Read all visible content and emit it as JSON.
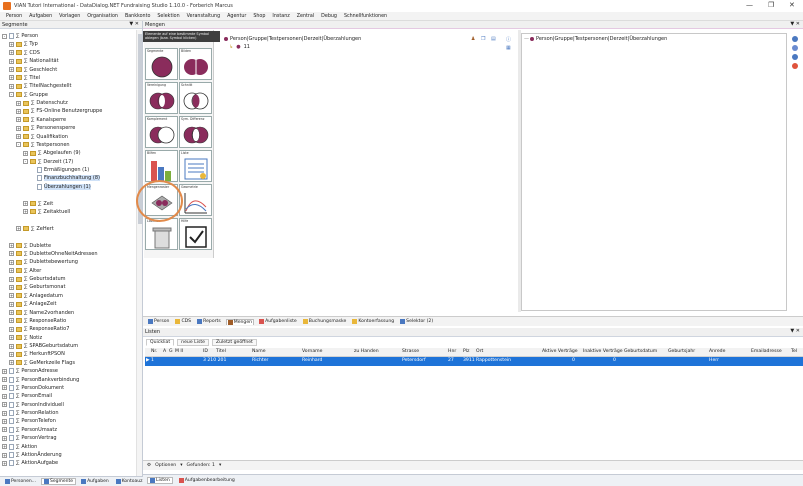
{
  "window": {
    "title": "VIAN Tutori International - DataDialog.NET Fundraising Studio 1.10.0 - Forberich Marcus"
  },
  "menu": [
    "Person",
    "Aufgaben",
    "Vorlagen",
    "Organisation",
    "Bankkonto",
    "Selektion",
    "Veranstaltung",
    "Agentur",
    "Shop",
    "Instanz",
    "Zentral",
    "Debug",
    "Schnellfunktionen"
  ],
  "segments_pane": {
    "title": "Segmente"
  },
  "tree": [
    {
      "label": "Person",
      "level": 0,
      "exp": "-",
      "icon": "doc"
    },
    {
      "label": "Typ",
      "level": 1,
      "exp": "+",
      "icon": "fold"
    },
    {
      "label": "CDS",
      "level": 1,
      "exp": "+",
      "icon": "fold"
    },
    {
      "label": "Nationalität",
      "level": 1,
      "exp": "+",
      "icon": "fold"
    },
    {
      "label": "Geschlecht",
      "level": 1,
      "exp": "+",
      "icon": "fold"
    },
    {
      "label": "Titel",
      "level": 1,
      "exp": "+",
      "icon": "fold"
    },
    {
      "label": "TitelNachgestellt",
      "level": 1,
      "exp": "+",
      "icon": "fold"
    },
    {
      "label": "Gruppe",
      "level": 1,
      "exp": "-",
      "icon": "fold"
    },
    {
      "label": "Datenschutz",
      "level": 2,
      "exp": "+",
      "icon": "fold"
    },
    {
      "label": "FS-Online Benutzergruppe",
      "level": 2,
      "exp": "+",
      "icon": "fold"
    },
    {
      "label": "Kanalsperre",
      "level": 2,
      "exp": "+",
      "icon": "fold"
    },
    {
      "label": "Personensperre",
      "level": 2,
      "exp": "+",
      "icon": "fold"
    },
    {
      "label": "Qualifikation",
      "level": 2,
      "exp": "+",
      "icon": "fold"
    },
    {
      "label": "Testpersonen",
      "level": 2,
      "exp": "-",
      "icon": "fold"
    },
    {
      "label": "Abgelaufen (9)",
      "level": 3,
      "exp": "+",
      "icon": "fold"
    },
    {
      "label": "Derzeit (17)",
      "level": 3,
      "exp": "-",
      "icon": "fold"
    },
    {
      "label": "Ermäßigungen (1)",
      "level": 4,
      "exp": "",
      "icon": "doc"
    },
    {
      "label": "Finanzbuchhaltung (8)",
      "level": 4,
      "exp": "",
      "icon": "doc",
      "sel": true
    },
    {
      "label": "Überzahlungen (1)",
      "level": 4,
      "exp": "",
      "icon": "doc",
      "sel": true
    },
    {
      "label": "",
      "level": 4,
      "exp": "",
      "icon": "none"
    },
    {
      "label": "Zeit",
      "level": 3,
      "exp": "+",
      "icon": "fold"
    },
    {
      "label": "Zeitaktuell",
      "level": 3,
      "exp": "+",
      "icon": "fold"
    },
    {
      "label": "",
      "level": 3,
      "exp": "",
      "icon": "none"
    },
    {
      "label": "ZeHert",
      "level": 2,
      "exp": "+",
      "icon": "fold"
    },
    {
      "label": "",
      "level": 2,
      "exp": "",
      "icon": "none"
    },
    {
      "label": "Dublette",
      "level": 1,
      "exp": "+",
      "icon": "fold"
    },
    {
      "label": "DubletteOhneNeitAdressen",
      "level": 1,
      "exp": "+",
      "icon": "fold"
    },
    {
      "label": "Dublettebewertung",
      "level": 1,
      "exp": "+",
      "icon": "fold"
    },
    {
      "label": "Alter",
      "level": 1,
      "exp": "+",
      "icon": "fold"
    },
    {
      "label": "Geburtsdatum",
      "level": 1,
      "exp": "+",
      "icon": "fold"
    },
    {
      "label": "Geburtsmonat",
      "level": 1,
      "exp": "+",
      "icon": "fold"
    },
    {
      "label": "Anlagedatum",
      "level": 1,
      "exp": "+",
      "icon": "fold"
    },
    {
      "label": "AnlageZeit",
      "level": 1,
      "exp": "+",
      "icon": "fold"
    },
    {
      "label": "Name2vorhanden",
      "level": 1,
      "exp": "+",
      "icon": "fold"
    },
    {
      "label": "ResponseRatio",
      "level": 1,
      "exp": "+",
      "icon": "fold"
    },
    {
      "label": "ResponseRatio7",
      "level": 1,
      "exp": "+",
      "icon": "fold"
    },
    {
      "label": "Notiz",
      "level": 1,
      "exp": "+",
      "icon": "fold"
    },
    {
      "label": "SPABGeburtsdatum",
      "level": 1,
      "exp": "+",
      "icon": "fold"
    },
    {
      "label": "HerkunftPSON",
      "level": 1,
      "exp": "+",
      "icon": "fold"
    },
    {
      "label": "GeMerkzeile Flags",
      "level": 1,
      "exp": "+",
      "icon": "fold"
    },
    {
      "label": "PersonAdresse",
      "level": 0,
      "exp": "+",
      "icon": "doc"
    },
    {
      "label": "PersonBankverbindung",
      "level": 0,
      "exp": "+",
      "icon": "doc"
    },
    {
      "label": "PersonDokument",
      "level": 0,
      "exp": "+",
      "icon": "doc"
    },
    {
      "label": "PersonEmail",
      "level": 0,
      "exp": "+",
      "icon": "doc"
    },
    {
      "label": "PersonIndividuell",
      "level": 0,
      "exp": "+",
      "icon": "doc"
    },
    {
      "label": "PersonRelation",
      "level": 0,
      "exp": "+",
      "icon": "doc"
    },
    {
      "label": "PersonTelefon",
      "level": 0,
      "exp": "+",
      "icon": "doc"
    },
    {
      "label": "PersonUmsatz",
      "level": 0,
      "exp": "+",
      "icon": "doc"
    },
    {
      "label": "PersonVertrag",
      "level": 0,
      "exp": "+",
      "icon": "doc"
    },
    {
      "label": "Aktion",
      "level": 0,
      "exp": "+",
      "icon": "doc"
    },
    {
      "label": "AktionÄnderung",
      "level": 0,
      "exp": "+",
      "icon": "doc"
    },
    {
      "label": "AktionAufgabe",
      "level": 0,
      "exp": "+",
      "icon": "doc"
    }
  ],
  "seg_tabs": [
    "Personen...",
    "Segmente",
    "Aufgaben",
    "Kontoauz..."
  ],
  "mengen_pane": {
    "title": "Mengen"
  },
  "tooltip": {
    "line1": "Elemente auf eine bestimmte Symbol",
    "line2": "ablegen (bzw. Symbol klicken)"
  },
  "palette": [
    {
      "label": "Segmente",
      "kind": "circle"
    },
    {
      "label": "Bilden",
      "kind": "split"
    },
    {
      "label": "Vereinigung",
      "kind": "union"
    },
    {
      "label": "Schnitt",
      "kind": "intersect"
    },
    {
      "label": "Komplement",
      "kind": "complement"
    },
    {
      "label": "Sym. Differenz",
      "kind": "symdiff"
    },
    {
      "label": "Bilfen",
      "kind": "bars"
    },
    {
      "label": "Liste",
      "kind": "list"
    },
    {
      "label": "Mengenraster",
      "kind": "tool"
    },
    {
      "label": "Geometrie",
      "kind": "curve"
    },
    {
      "label": "Löschen",
      "kind": "trash"
    },
    {
      "label": "Hilfe",
      "kind": "check"
    }
  ],
  "set_doc": {
    "path": "Person|Gruppe|Testpersonen|Derzeit|Überzahlungen",
    "count": "11"
  },
  "right_doc": {
    "path": "Person|Gruppe|Testpersonen|Derzeit|Überzahlungen"
  },
  "bottom_tabs": [
    {
      "label": "Person",
      "active": false
    },
    {
      "label": "CDS",
      "active": false
    },
    {
      "label": "Reports",
      "active": false
    },
    {
      "label": "Mengen",
      "active": true
    },
    {
      "label": "Aufgabenliste",
      "active": false
    },
    {
      "label": "Buchungsmaske",
      "active": false
    },
    {
      "label": "Kontoerfassung",
      "active": false
    },
    {
      "label": "Selektor (2)",
      "active": false
    }
  ],
  "listen_pane": {
    "title": "Listen"
  },
  "list_tabs": [
    "Quickliat",
    "neue Liste",
    "Zuletzt geöffnet"
  ],
  "grid": {
    "columns": [
      "Nr.",
      "A",
      "G",
      "M II",
      "ID",
      "Titel",
      "Name",
      "Vorname",
      "zu Handen",
      "Strasse",
      "Hnr",
      "Plz",
      "Ort",
      "Aktive Verträge",
      "Inaktive Verträge",
      "Geburtsdatum",
      "Geburtsjahr",
      "Anrede",
      "Emailadresse",
      "Tel"
    ],
    "row": [
      "1",
      "",
      "",
      "",
      "3 210 201",
      "",
      "Richter",
      "Reinhard",
      "",
      "Petersdorf",
      "27",
      "3911",
      "Rappottenstein",
      "0",
      "0",
      "",
      "",
      "Herr",
      "",
      ""
    ]
  },
  "options_bar": {
    "options": "Optionen",
    "found": "Gefunden: 1"
  },
  "status_tabs": [
    "Listen",
    "Aufgabenbearbeitung"
  ]
}
